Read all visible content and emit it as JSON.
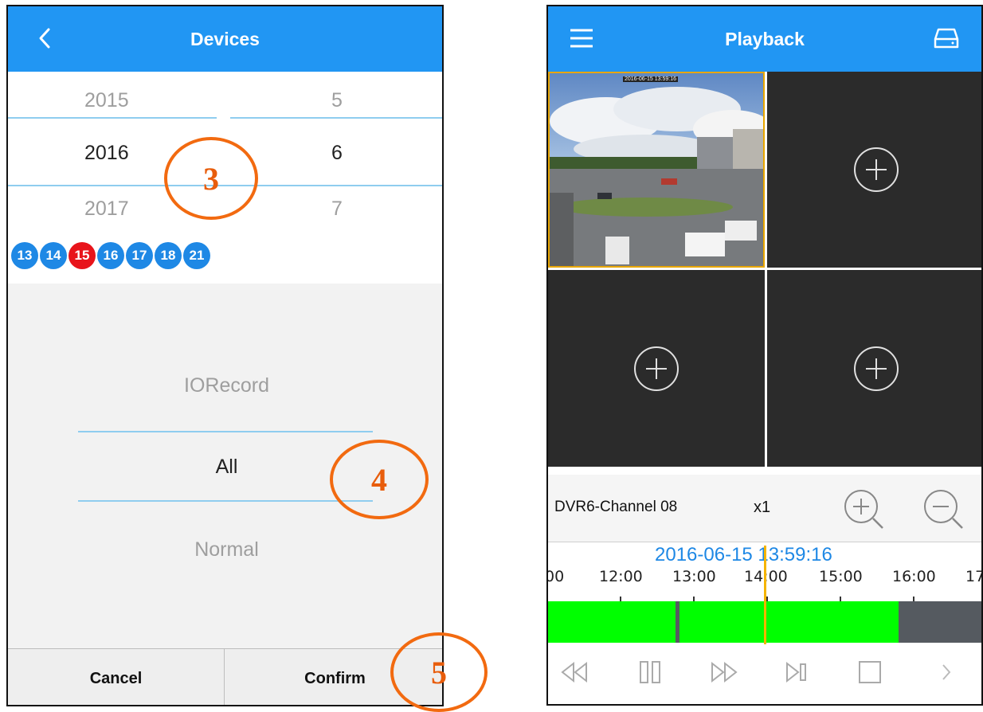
{
  "left": {
    "title": "Devices",
    "years": [
      "2015",
      "2016",
      "2017"
    ],
    "months": [
      "5",
      "6",
      "7"
    ],
    "dates": [
      {
        "label": "13",
        "active": false
      },
      {
        "label": "14",
        "active": false
      },
      {
        "label": "15",
        "active": true
      },
      {
        "label": "16",
        "active": false
      },
      {
        "label": "17",
        "active": false
      },
      {
        "label": "18",
        "active": false
      },
      {
        "label": "21",
        "active": false
      }
    ],
    "record_types": [
      "IORecord",
      "All",
      "Normal"
    ],
    "cancel_label": "Cancel",
    "confirm_label": "Confirm"
  },
  "annotations": [
    "3",
    "4",
    "5"
  ],
  "right": {
    "title": "Playback",
    "camera_timestamp": "2016-06-15 13:59:16",
    "channel": "DVR6-Channel 08",
    "speed": "x1",
    "timeline_time": "2016-06-15 13:59:16",
    "ticks": [
      "00",
      "12:00",
      "13:00",
      "14:00",
      "15:00",
      "16:00",
      "17"
    ]
  },
  "colors": {
    "accent": "#2196f3",
    "selected_date": "#e8141b",
    "record": "#00ff00",
    "cursor": "#f5b400",
    "annotation": "#f26a10"
  }
}
